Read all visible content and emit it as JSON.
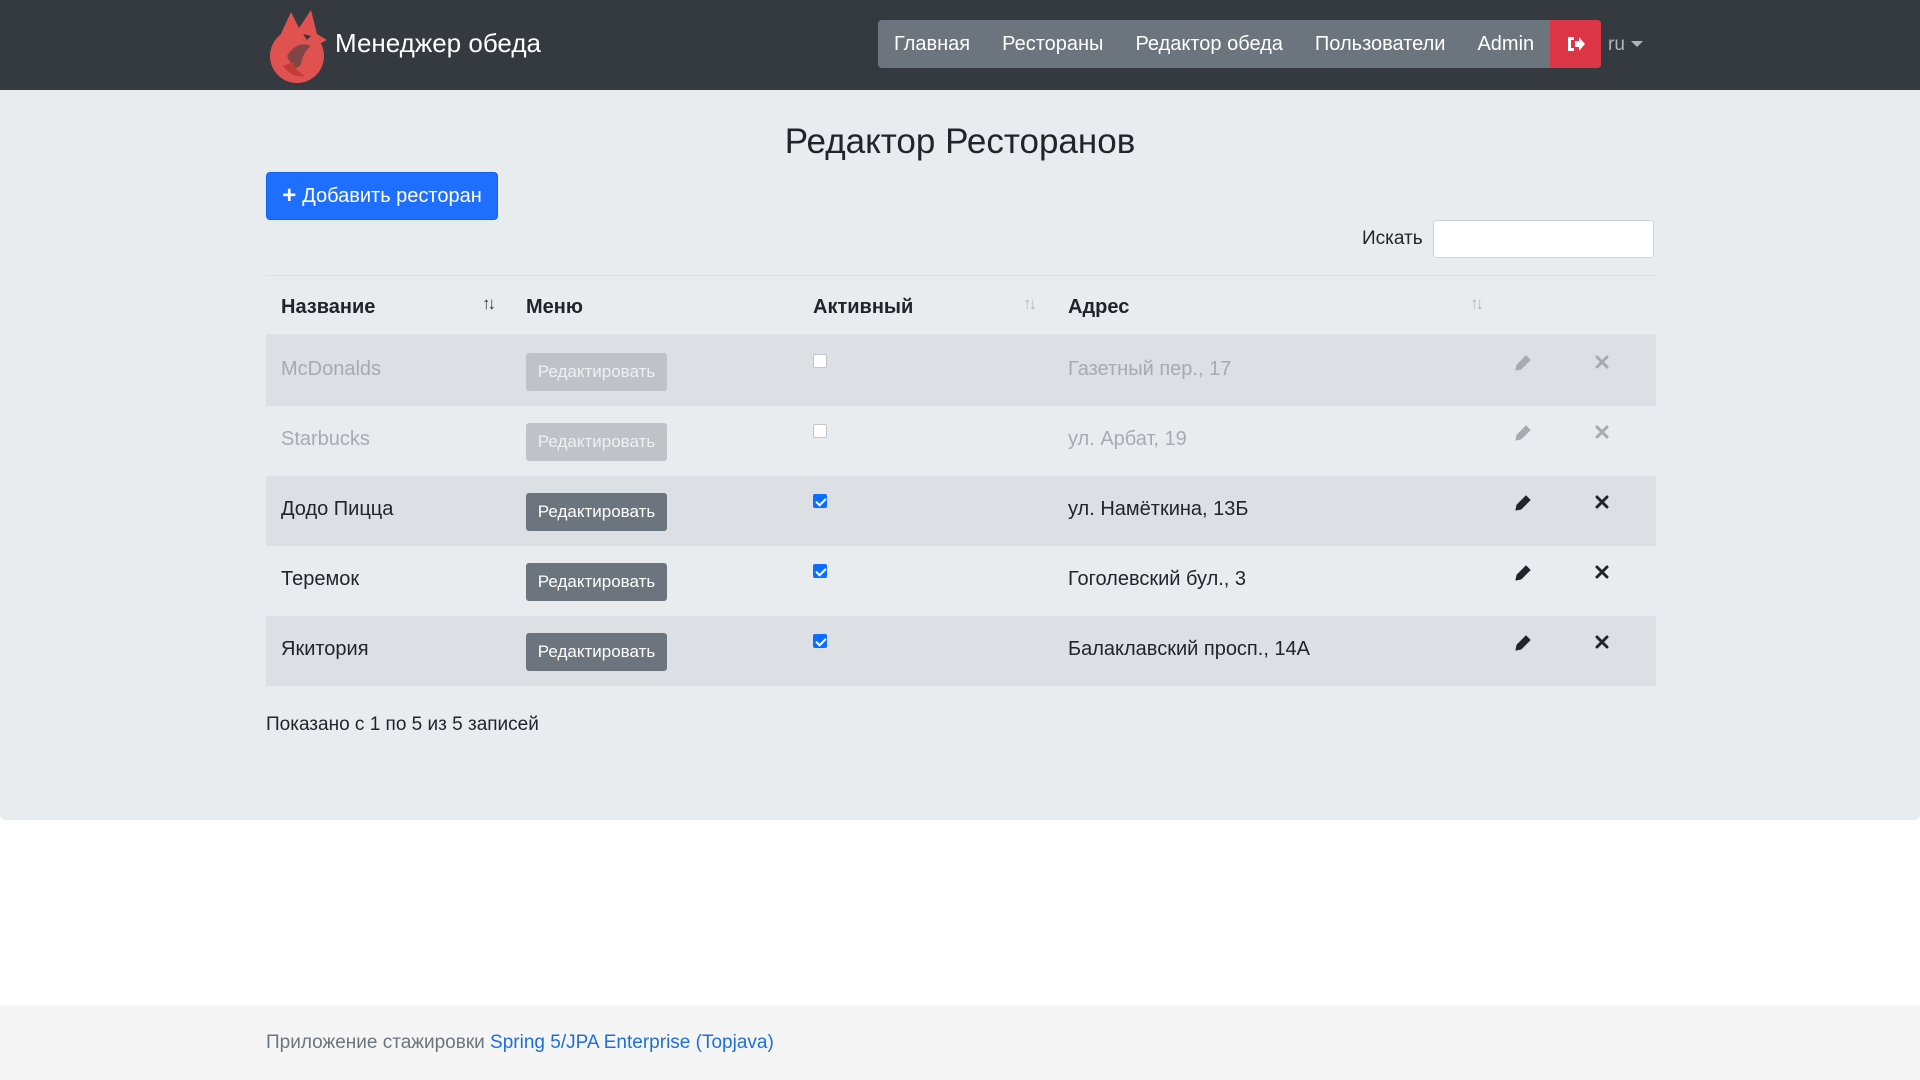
{
  "navbar": {
    "brand": "Менеджер обеда",
    "items": [
      {
        "label": "Главная"
      },
      {
        "label": "Рестораны"
      },
      {
        "label": "Редактор обеда"
      },
      {
        "label": "Пользователи"
      },
      {
        "label": "Admin"
      }
    ],
    "logout_icon": "sign-out-icon",
    "lang": "ru"
  },
  "page": {
    "title": "Редактор Ресторанов",
    "add_button": "Добавить ресторан",
    "search_label": "Искать",
    "search_value": ""
  },
  "table": {
    "headers": [
      "Название",
      "Меню",
      "Активный",
      "Адрес"
    ],
    "sort_glyph": "↑↓",
    "rows": [
      {
        "name": "McDonalds",
        "menu_button": "Редактировать",
        "active": false,
        "address": "Газетный пер., 17"
      },
      {
        "name": "Starbucks",
        "menu_button": "Редактировать",
        "active": false,
        "address": "ул. Арбат, 19"
      },
      {
        "name": "Додо Пицца",
        "menu_button": "Редактировать",
        "active": true,
        "address": "ул. Намёткина, 13Б"
      },
      {
        "name": "Теремок",
        "menu_button": "Редактировать",
        "active": true,
        "address": "Гоголевский бул., 3"
      },
      {
        "name": "Якитория",
        "menu_button": "Редактировать",
        "active": true,
        "address": "Балаклавский просп., 14А"
      }
    ],
    "info": "Показано с 1 по 5 из 5 записей"
  },
  "footer": {
    "text": "Приложение стажировки",
    "link": "Spring 5/JPA Enterprise (Topjava)"
  },
  "colors": {
    "navbar": "#343a40",
    "primary": "#1f6fff",
    "danger": "#dc3545",
    "secondary": "#6c757d",
    "jumbotron": "#e9ecef"
  }
}
